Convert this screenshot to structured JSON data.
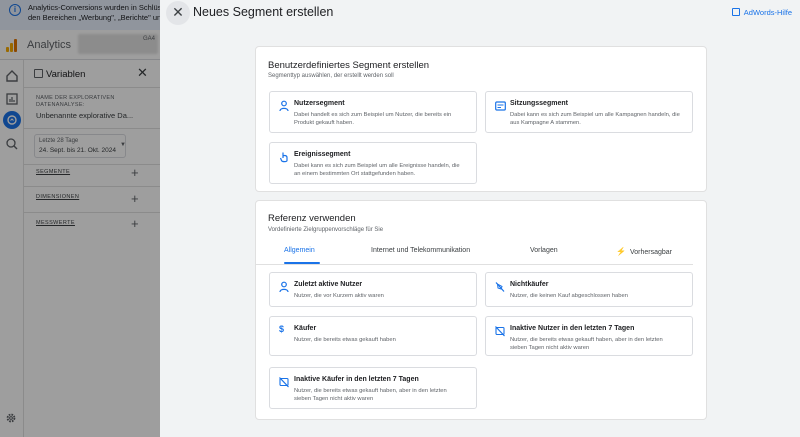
{
  "background": {
    "banner_line1": "Analytics-Conversions wurden in Schlüssel",
    "banner_line2": "den Bereichen „Werbung\", „Berichte\" und „E",
    "app_name": "Analytics",
    "account_suffix": "GA4",
    "panel": {
      "title": "Variablen",
      "exploration_label_1": "NAME DER EXPLORATIVEN",
      "exploration_label_2": "DATENANALYSE:",
      "exploration_name": "Unbenannte explorative Da...",
      "date_label": "Letzte 28 Tage",
      "date_range": "24. Sept. bis 21. Okt. 2024",
      "sections": [
        "SEGMENTE",
        "DIMENSIONEN",
        "MESSWERTE"
      ]
    }
  },
  "dialog": {
    "title": "Neues Segment erstellen",
    "help_link": "AdWords-Hilfe",
    "custom": {
      "title": "Benutzerdefiniertes Segment erstellen",
      "subtitle": "Segmenttyp auswählen, der erstellt werden soll",
      "options": [
        {
          "icon": "person-icon",
          "title": "Nutzersegment",
          "desc_1": "Dabei handelt es sich zum Beispiel um Nutzer, die bereits ein",
          "desc_2": "Produkt gekauft haben."
        },
        {
          "icon": "session-icon",
          "title": "Sitzungssegment",
          "desc_1": "Dabei kann es sich zum Beispiel um alle Kampagnen handeln, die",
          "desc_2": "aus Kampagne A stammen."
        },
        {
          "icon": "event-icon",
          "title": "Ereignissegment",
          "desc_1": "Dabei kann es sich zum Beispiel um alle Ereignisse handeln, die",
          "desc_2": "an einem bestimmten Ort stattgefunden haben."
        }
      ]
    },
    "reference": {
      "title": "Referenz verwenden",
      "subtitle": "Vordefinierte Zielgruppenvorschläge für Sie",
      "tabs": [
        "Allgemein",
        "Internet und Telekommunikation",
        "Vorlagen",
        "Vorhersagbar"
      ],
      "active_tab": "Allgemein",
      "options": [
        {
          "icon": "person-icon",
          "title": "Zuletzt aktive Nutzer",
          "desc_1": "Nutzer, die vor Kurzem aktiv waren",
          "desc_2": "",
          "desc_3": ""
        },
        {
          "icon": "no-purchase-icon",
          "title": "Nichtkäufer",
          "desc_1": "Nutzer, die keinen Kauf abgeschlossen haben",
          "desc_2": "",
          "desc_3": ""
        },
        {
          "icon": "dollar-icon",
          "title": "Käufer",
          "desc_1": "Nutzer, die bereits etwas gekauft haben",
          "desc_2": "",
          "desc_3": ""
        },
        {
          "icon": "inactive-icon",
          "title": "Inaktive Nutzer in den letzten 7 Tagen",
          "desc_1": "Nutzer, die bereits etwas gekauft haben, aber in den letzten",
          "desc_2": "sieben Tagen nicht aktiv waren",
          "desc_3": ""
        },
        {
          "icon": "inactive-icon",
          "title": "Inaktive Käufer in den letzten 7 Tagen",
          "desc_1": "Nutzer, die bereits etwas gekauft haben, aber in den letzten",
          "desc_2": "sieben Tagen nicht aktiv waren",
          "desc_3": ""
        }
      ]
    }
  },
  "colors": {
    "accent": "#1a73e8",
    "dialog_bg": "#f1f3f4",
    "card_bg": "#ffffff"
  }
}
